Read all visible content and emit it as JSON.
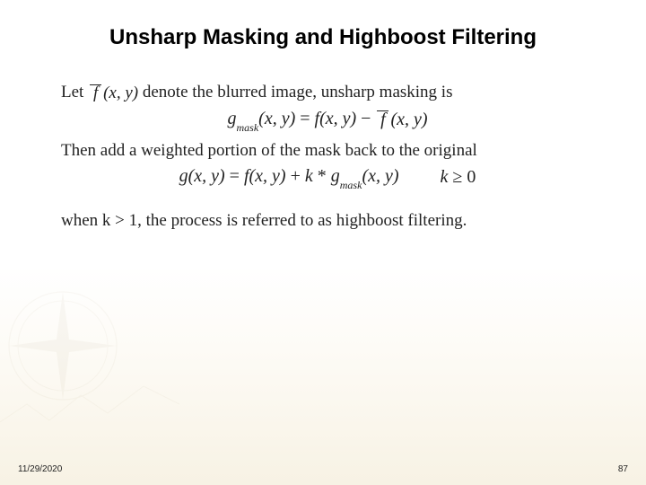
{
  "title": "Unsharp Masking and Highboost Filtering",
  "lines": {
    "let_prefix": "Let",
    "let_suffix": "denote the blurred image, unsharp masking is",
    "then_text": "Then add a weighted portion of the mask back to the original",
    "when_text": "when k > 1, the process is referred to as highboost filtering."
  },
  "eq": {
    "fbar_args": "(x, y)",
    "gmask_lhs": "g",
    "gmask_sub": "mask",
    "xy": "(x, y)",
    "eq_sign": " = ",
    "f": "f",
    "minus": " − ",
    "plus": " + ",
    "k": "k",
    "star": "* ",
    "g": "g",
    "ge": " ≥ ",
    "zero": "0"
  },
  "footer": {
    "date": "11/29/2020",
    "page": "87"
  }
}
